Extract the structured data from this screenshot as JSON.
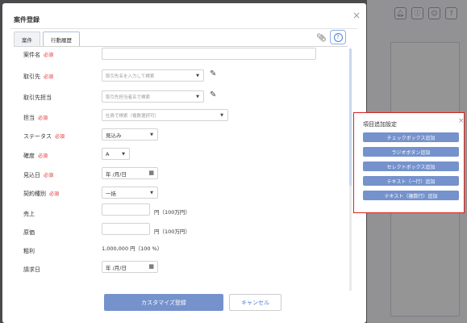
{
  "background": {
    "toolbar_icons": [
      "bell-icon",
      "info-icon",
      "user-icon",
      "help-icon"
    ]
  },
  "modal": {
    "title": "案件登録",
    "tabs": [
      "案件",
      "行動履歴"
    ],
    "fields": {
      "name": {
        "label": "案件名",
        "required": "必須",
        "value": ""
      },
      "client": {
        "label": "取引先",
        "required": "必須",
        "placeholder": "取引先名を入力して検索"
      },
      "client_contact": {
        "label": "取引先担当",
        "placeholder": "取引先担当者名で検索"
      },
      "owner": {
        "label": "担当",
        "required": "必須",
        "placeholder": "社員で検索（複数選択可）"
      },
      "status": {
        "label": "ステータス",
        "required": "必須",
        "value": "見込み"
      },
      "certainty": {
        "label": "確度",
        "required": "必須",
        "value": "A"
      },
      "expected_date": {
        "label": "見込日",
        "required": "必須",
        "value": "年 /月/日"
      },
      "contract_type": {
        "label": "契約種別",
        "required": "必須",
        "value": "一括"
      },
      "sales": {
        "label": "売上",
        "value": "",
        "unit": "円（100万円）"
      },
      "cost": {
        "label": "原価",
        "value": "",
        "unit": "円（100万円）"
      },
      "gross_profit": {
        "label": "粗利",
        "value": "1,000,000 円（100 %）"
      },
      "billing_date": {
        "label": "請求日",
        "value": "年 /月/日"
      }
    },
    "buttons": {
      "submit": "カスタマイズ登録",
      "cancel": "キャンセル"
    }
  },
  "side_panel": {
    "title": "項目追加設定",
    "buttons": [
      "チェックボックス追加",
      "ラジオボタン追加",
      "セレクトボックス追加",
      "テキスト（一行）追加",
      "テキスト（複数行）追加"
    ]
  },
  "colors": {
    "accent": "#7592cc",
    "required": "#e0312e",
    "highlight_border": "#d9221c"
  }
}
